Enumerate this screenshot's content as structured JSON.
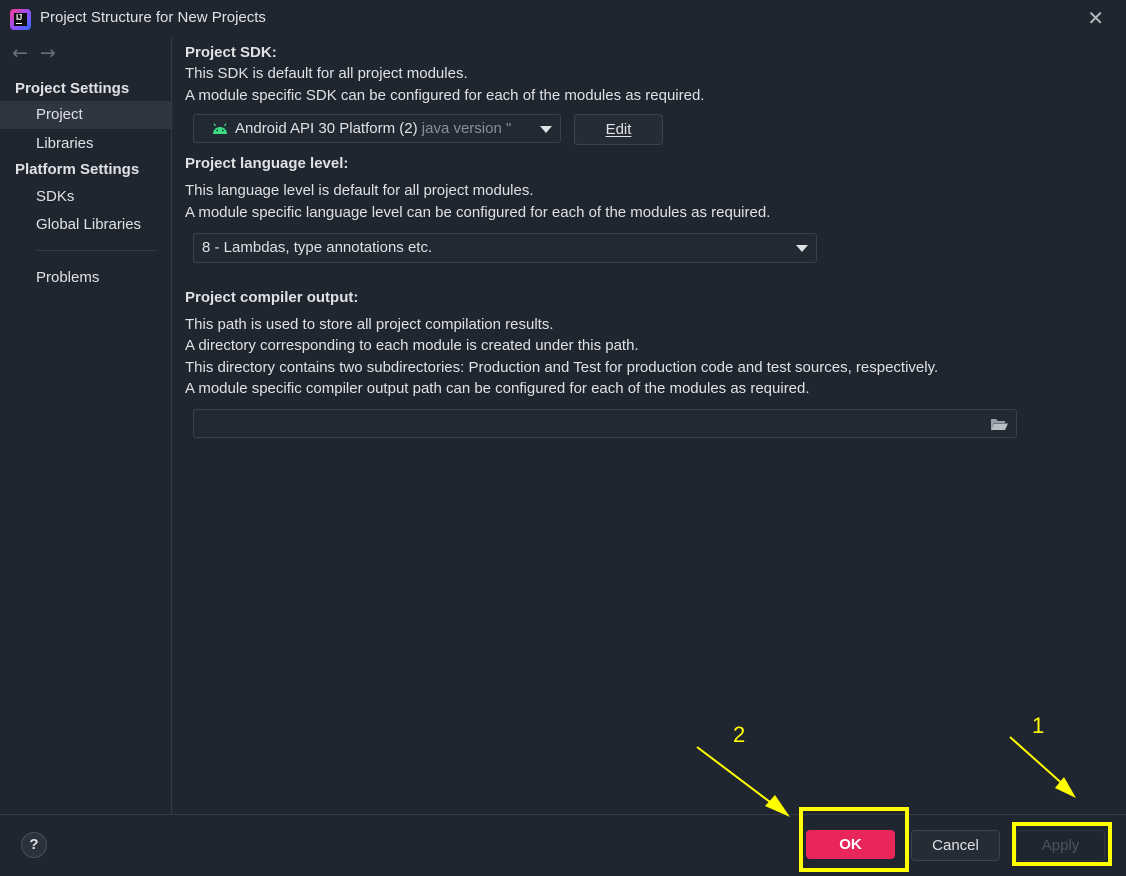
{
  "window": {
    "title": "Project Structure for New Projects",
    "close_glyph": "✕"
  },
  "sidebar": {
    "back_glyph": "←",
    "forward_glyph": "→",
    "project_settings_header": "Project Settings",
    "platform_settings_header": "Platform Settings",
    "items": {
      "project": "Project",
      "libraries": "Libraries",
      "sdks": "SDKs",
      "global_libraries": "Global Libraries",
      "problems": "Problems"
    },
    "selected": "Project"
  },
  "sdk": {
    "title": "Project SDK:",
    "desc1": "This SDK is default for all project modules.",
    "desc2": "A module specific SDK can be configured for each of the modules as required.",
    "selected_name": "Android API 30 Platform (2)",
    "selected_detail": "java version \"",
    "edit_label": "Edit"
  },
  "language_level": {
    "title": "Project language level:",
    "desc1": "This language level is default for all project modules.",
    "desc2": "A module specific language level can be configured for each of the modules as required.",
    "selected": "8 - Lambdas, type annotations etc."
  },
  "compiler_output": {
    "title": "Project compiler output:",
    "desc1": "This path is used to store all project compilation results.",
    "desc2": "A directory corresponding to each module is created under this path.",
    "desc3": "This directory contains two subdirectories: Production and Test for production code and test sources, respectively.",
    "desc4": "A module specific compiler output path can be configured for each of the modules as required.",
    "path_value": ""
  },
  "footer": {
    "help_label": "?",
    "ok_label": "OK",
    "cancel_label": "Cancel",
    "apply_label": "Apply"
  },
  "annotations": {
    "step1": "1",
    "step2": "2",
    "highlight_color": "#ffff00"
  },
  "colors": {
    "background": "#20262f",
    "ok_button": "#e8265a",
    "android_green": "#3ddc84"
  }
}
